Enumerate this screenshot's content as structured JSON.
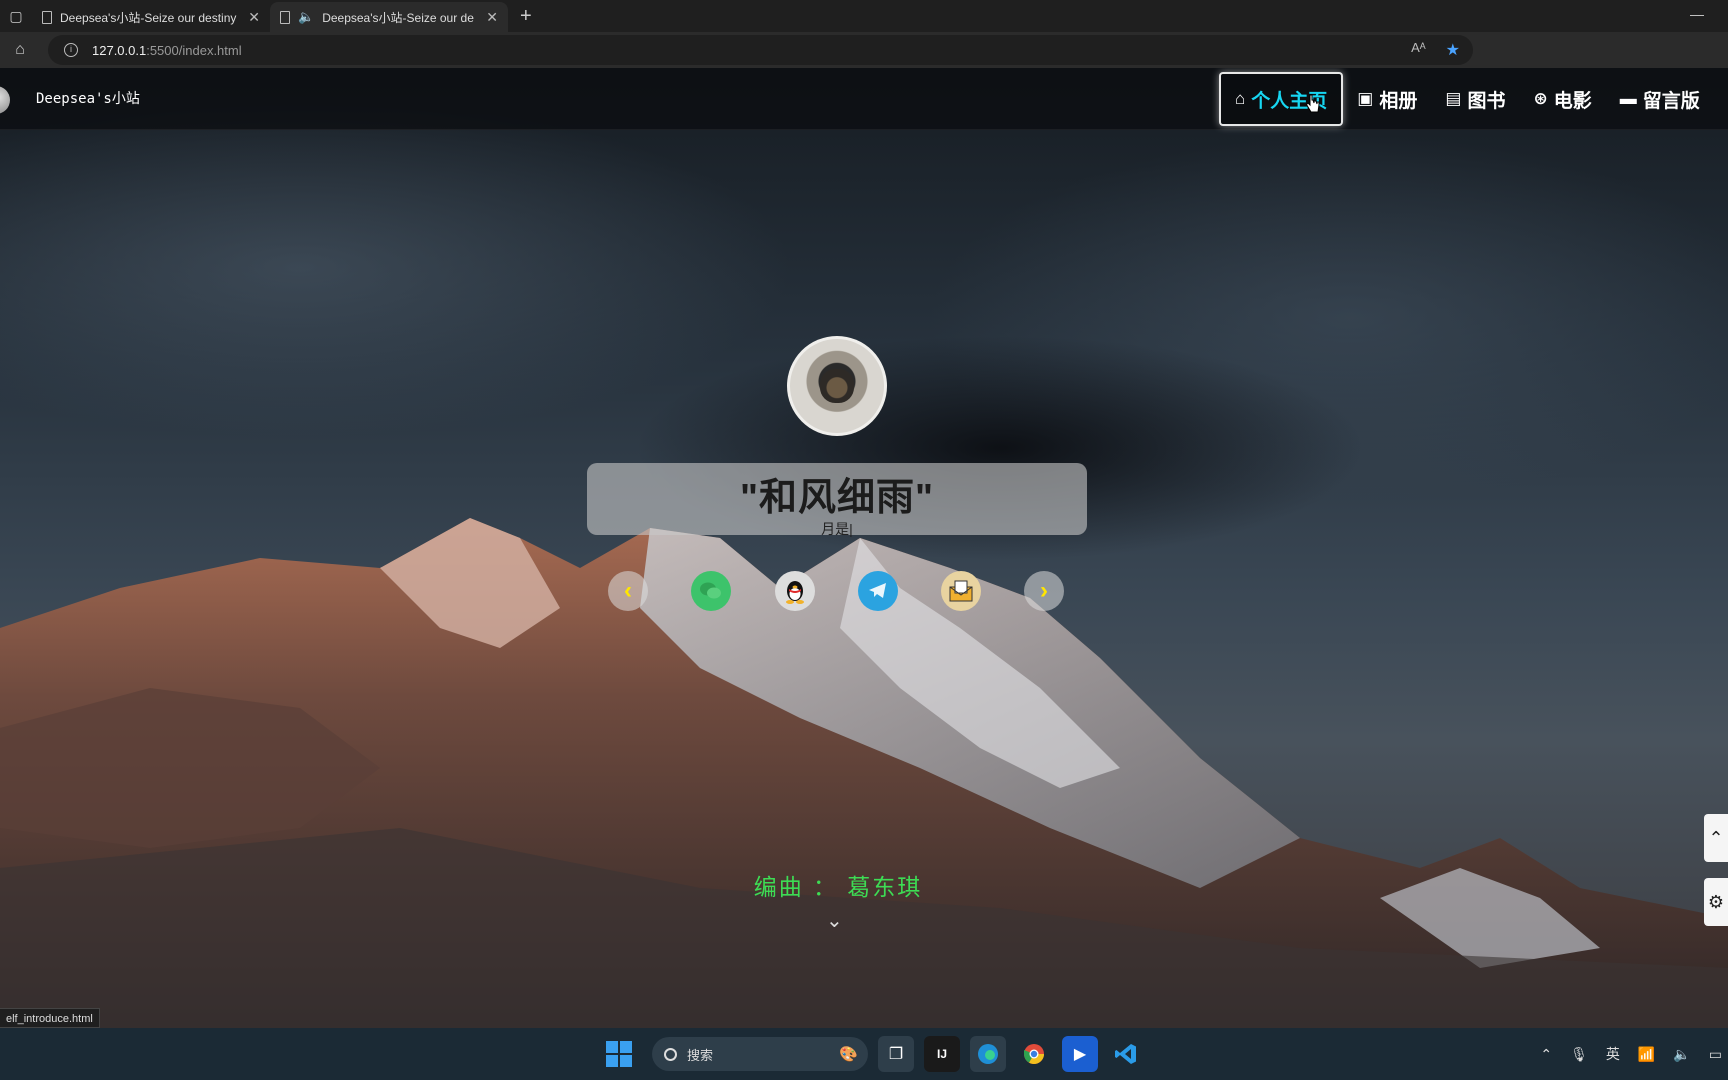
{
  "browser": {
    "tabs": [
      {
        "title": "Deepsea's小站-Seize our destiny",
        "close": "✕"
      },
      {
        "title": "Deepsea's小站-Seize our de",
        "close": "✕"
      }
    ],
    "new_tab": "+",
    "minimize": "—",
    "url_host": "127.0.0.1",
    "url_path": ":5500/index.html",
    "read_aloud": "Aᴬ"
  },
  "site": {
    "title": "Deepsea's小站",
    "nav": [
      {
        "label": "个人主页",
        "icon": "home-icon",
        "glyph": "⌂",
        "active": true
      },
      {
        "label": "相册",
        "icon": "image-icon",
        "glyph": "▣"
      },
      {
        "label": "图书",
        "icon": "save-icon",
        "glyph": "▤"
      },
      {
        "label": "电影",
        "icon": "film-reel-icon",
        "glyph": "⊛"
      },
      {
        "label": "留言版",
        "icon": "comment-icon",
        "glyph": "▬"
      }
    ],
    "quote": "\"和风细雨\"",
    "subline": "月是|",
    "credit": "编曲 ： 葛东琪",
    "prev": "‹",
    "next": "›",
    "down": "⌄",
    "scroll_top": "⌃",
    "settings": "⚙"
  },
  "statusbar": {
    "link": "elf_introduce.html"
  },
  "taskbar": {
    "search_label": "搜索",
    "ime": "英"
  },
  "colors": {
    "accent_active": "#17d6f2",
    "credit": "#3ddc54",
    "arrow": "#ffe600"
  }
}
